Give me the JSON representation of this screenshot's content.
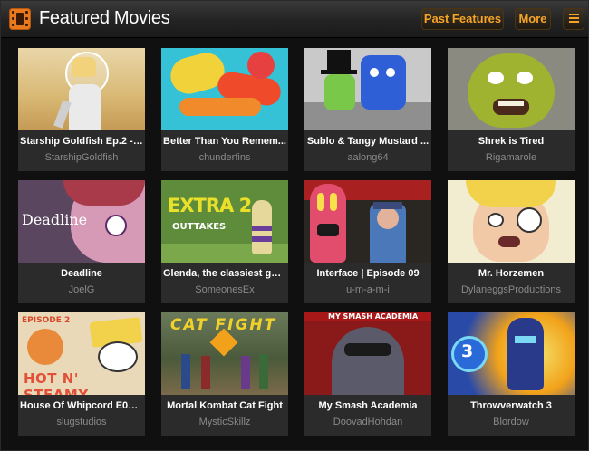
{
  "header": {
    "title": "Featured Movies",
    "icon": "film-icon",
    "past_features_label": "Past Features",
    "more_label": "More",
    "menu_icon": "list-menu-icon"
  },
  "colors": {
    "accent": "#f5a427",
    "card_bg": "#2b2b2b",
    "page_bg": "#101010"
  },
  "movies": [
    {
      "title": "Starship Goldfish Ep.2 - ...",
      "author": "StarshipGoldfish"
    },
    {
      "title": "Better Than You Remem...",
      "author": "chunderfins"
    },
    {
      "title": "Sublo & Tangy Mustard ...",
      "author": "aalong64"
    },
    {
      "title": "Shrek is Tired",
      "author": "Rigamarole"
    },
    {
      "title": "Deadline",
      "author": "JoelG",
      "thumb_text": "Deadline"
    },
    {
      "title": "Glenda, the classiest gal...",
      "author": "SomeonesEx",
      "thumb_text": "EXTRA 2",
      "thumb_subtext": "OUTTAKES"
    },
    {
      "title": "Interface | Episode 09",
      "author": "u-m-a-m-i"
    },
    {
      "title": "Mr. Horzemen",
      "author": "DylaneggsProductions"
    },
    {
      "title": "House Of Whipcord E02 ...",
      "author": "slugstudios",
      "thumb_text": "HOT N' STEAMY",
      "thumb_subtext": "EPISODE 2"
    },
    {
      "title": "Mortal Kombat Cat Fight",
      "author": "MysticSkillz",
      "thumb_text": "CAT FIGHT"
    },
    {
      "title": "My Smash Academia",
      "author": "DoovadHohdan",
      "thumb_text": "MY SMASH ACADEMIA"
    },
    {
      "title": "Throwverwatch 3",
      "author": "Blordow",
      "thumb_text": "3"
    }
  ]
}
